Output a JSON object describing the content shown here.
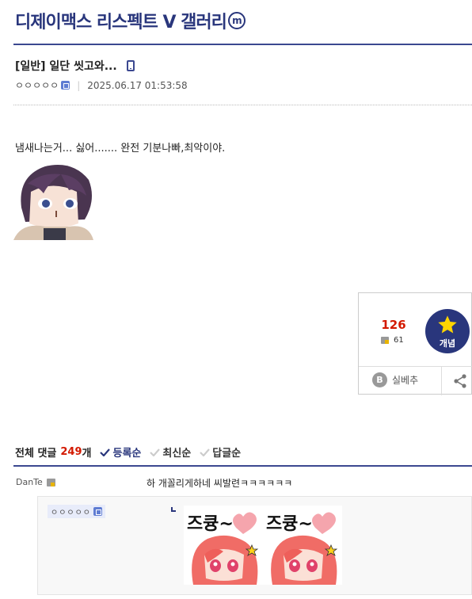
{
  "gallery": {
    "title": "디제이맥스 리스펙트 V 갤러리",
    "minor_badge": "m"
  },
  "post": {
    "title": "[일반] 일단 씻고와...",
    "author": "ㅇㅇㅇㅇㅇ",
    "date": "2025.06.17 01:53:58",
    "body": "냄새나는거... 싫어....... 완전 기분나빠,최악이야."
  },
  "vote": {
    "recommend_count": "126",
    "fixed_count": "61",
    "recommend_label": "개념",
    "real_label": "실베추",
    "real_icon": "B"
  },
  "comments": {
    "header_label": "전체 댓글",
    "count": "249",
    "count_unit": "개",
    "sort": [
      "등록순",
      "최신순",
      "답글순"
    ],
    "items": [
      {
        "nick": "DanTe",
        "text": "하 개꼴리게하네 씨발련ㅋㅋㅋㅋㅋㅋ"
      }
    ],
    "reply": {
      "nick": "ㅇㅇㅇㅇㅇ"
    }
  },
  "dccon": {
    "text": "즈큥~"
  },
  "colors": {
    "brand": "#29367c",
    "accent_red": "#d31900"
  }
}
